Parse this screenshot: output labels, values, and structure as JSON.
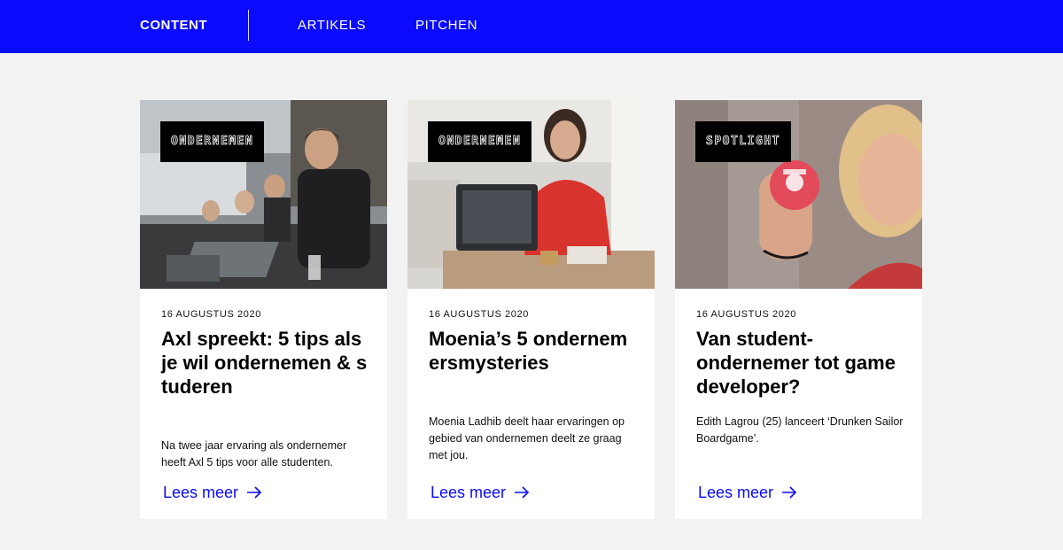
{
  "nav": {
    "brand": "CONTENT",
    "links": [
      "ARTIKELS",
      "PITCHEN"
    ]
  },
  "colors": {
    "accent": "#0a0aff",
    "background": "#f2f2f2",
    "card": "#ffffff",
    "tag_background": "#000000"
  },
  "cards": [
    {
      "tag": "ONDERNEMEN",
      "date": "16 AUGUSTUS 2020",
      "title": "Axl spreekt: 5 tips als je wil ondernemen & studeren",
      "excerpt": "Na twee jaar ervaring als ondernemer heeft Axl 5 tips voor alle studenten.",
      "link": "Lees meer",
      "link_icon": "arrow-right-icon"
    },
    {
      "tag": "ONDERNEMEN",
      "date": "16 AUGUSTUS 2020",
      "title": "Moenia’s 5 ondernemersmysteries",
      "excerpt": "Moenia Ladhib deelt haar ervaringen op gebied van ondernemen deelt ze graag met jou.",
      "link": "Lees meer",
      "link_icon": "arrow-right-icon"
    },
    {
      "tag": "SPOTLIGHT",
      "date": "16 AUGUSTUS 2020",
      "title": "Van student-ondernemer tot game developer?",
      "excerpt": "Edith Lagrou (25) lanceert ‘Drunken Sailor Boardgame’.",
      "link": "Lees meer",
      "link_icon": "arrow-right-icon"
    }
  ]
}
